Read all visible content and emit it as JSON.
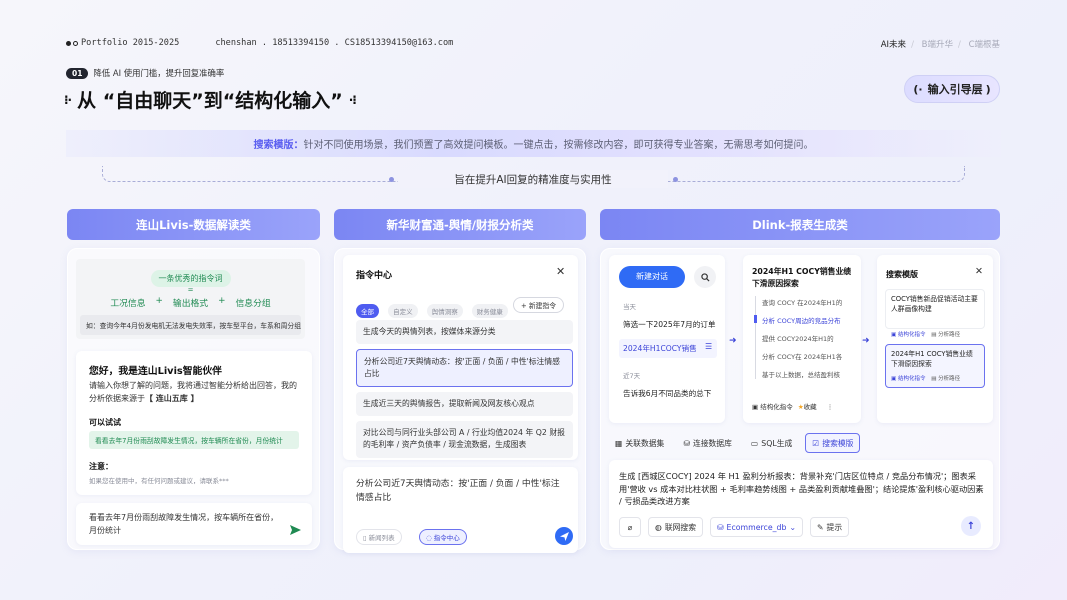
{
  "header": {
    "portfolio": "Portfolio 2015-2025",
    "contact": "chenshan . 18513394150 . CS18513394150@163.com",
    "nav": [
      "AI未来",
      "B端升华",
      "C端根基"
    ]
  },
  "section": {
    "num": "01",
    "tag": "降低 AI 使用门槛，提升回复准确率",
    "title": "从 “自由聊天”到“结构化输入”",
    "pill": "输入引导层"
  },
  "banner": {
    "lead": "搜索模版：",
    "text": "针对不同使用场景，我们预置了高效提问模板。一键点击，按需修改内容，即可获得专业答案，无需思考如何提问。"
  },
  "subtitle": "旨在提升AI回复的精准度与实用性",
  "col1": {
    "head": "连山Livis-数据解读类",
    "formula_title": "一条优秀的指令词",
    "eq": "=",
    "formula": [
      "工况信息",
      "+",
      "输出格式",
      "+",
      "信息分组"
    ],
    "example": "如：查询今年4月份发电机无法发电失效率，按车型平台，车系和周分组",
    "greet": "您好，我是连山Livis智能伙伴",
    "intro_a": "请输入你想了解的问题，我将通过智能分析给出回答，我的",
    "intro_b": "分析依据来源于",
    "source": "【 连山五库 】",
    "try_label": "可以试试",
    "try_text": "看看去年7月份雨刮故障发生情况，按车辆所在省份，月份统计",
    "note_label": "注意：",
    "note_text": "如果您在使用中，有任何问题或建议，请联系***",
    "input_a": "看看去年7月份雨刮故障发生情况，按车辆所在省份，",
    "input_b": "月份统计"
  },
  "col2": {
    "head": "新华财富通-舆情/财报分析类",
    "panel_title": "指令中心",
    "filters": [
      "全部",
      "自定义",
      "舆情洞察",
      "财务健康"
    ],
    "new_btn": "+ 新建指令",
    "items": [
      "生成今天的舆情列表，按媒体来源分类",
      "分析公司近7天舆情动态：按'正面 / 负面 / 中性'标注情感占比",
      "生成近三天的舆情报告，提取新闻及网友核心观点",
      "对比公司与同行业头部公司 A / 行业均值2024 年 Q2 财报的毛利率 / 资产负债率 / 现金流数据，生成图表"
    ],
    "input": "分析公司近7天舆情动态：按'正面 / 负面 / 中性'标注情感占比",
    "tag1": "新闻列表",
    "tag2": "指令中心"
  },
  "col3": {
    "head": "Dlink-报表生成类",
    "new_chat": "新建对话",
    "today": "当天",
    "h1": "筛选一下2025年7月的订单",
    "h2": "2024年H1COCY销售",
    "recent": "近7天",
    "h3": "告诉我6月不同品类的总下",
    "mid_title": "2024年H1 COCY销售业绩下滑原因探索",
    "mid_items": [
      "查询 COCY 在2024年H1的",
      "分析 COCY周边的竞品分布",
      "提供 COCY2024年H1的",
      "分析 COCY在 2024年H1各",
      "基于以上数据，总结盈利核"
    ],
    "mid_tag": "结构化指令",
    "mid_fav": "收藏",
    "right_title": "搜索模版",
    "tpl1": "COCY销售新品促销活动主要人群画像构建",
    "tpl2": "2024年H1 COCY销售业绩下滑原因探索",
    "tpl_tag1": "结构化指令",
    "tpl_tag2": "分析路径",
    "tools": [
      "关联数据集",
      "连接数据库",
      "SQL生成",
      "搜索模版"
    ],
    "prompt": "生成 [西城区COCY] 2024 年 H1 盈利分析报表：背景补充'门店区位特点 / 竞品分布情况'；图表采用'营收 vs 成本对比柱状图 + 毛利率趋势线图 + 品类盈利贡献堆叠图'；结论提炼'盈利核心驱动因素 / 亏损品类改进方案",
    "b_search": "联网搜索",
    "b_db": "Ecommerce_db",
    "b_hint": "提示"
  },
  "colors": {
    "accent": "#5b5ff0",
    "send": "#2f6bf5",
    "green": "#1f8a52"
  }
}
